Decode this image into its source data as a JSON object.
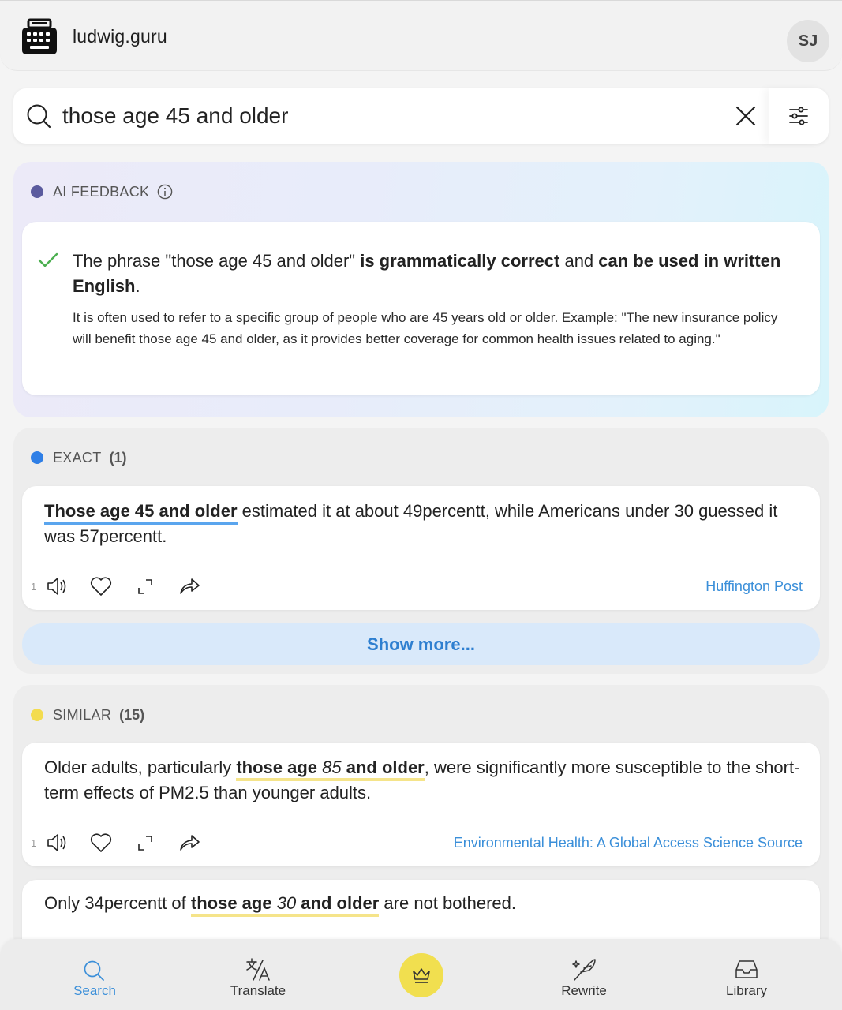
{
  "header": {
    "brand": "ludwig.guru",
    "avatar_initials": "SJ"
  },
  "search": {
    "query": "those age 45 and older",
    "placeholder": ""
  },
  "ai_feedback": {
    "label": "AI FEEDBACK",
    "dot_color": "#5b5b9e",
    "main_parts": [
      "The phrase \"those age 45 and older\" ",
      "is grammatically correct",
      " and ",
      "can be used in written English",
      "."
    ],
    "explanation": "It is often used to refer to a specific group of people who are 45 years old or older. Example: \"The new insurance policy will benefit those age 45 and older, as it provides better coverage for common health issues related to aging.\""
  },
  "exact": {
    "label": "EXACT",
    "count": "(1)",
    "dot_color": "#2f7fe6",
    "results": [
      {
        "index": "1",
        "before": "",
        "highlight": "Those age 45 and older",
        "after": " estimated it at about 49percentt, while Americans under 30 guessed it was 57percentt.",
        "source": "Huffington Post"
      }
    ],
    "show_more": "Show more..."
  },
  "similar": {
    "label": "SIMILAR",
    "count": "(15)",
    "dot_color": "#f3dc4f",
    "results": [
      {
        "index": "1",
        "before": "Older adults, particularly ",
        "hl_a": "those age ",
        "hl_var": "85",
        "hl_b": " and older",
        "after": ", were significantly more susceptible to the short-term effects of PM2.5 than younger adults.",
        "source": "Environmental Health: A Global Access Science Source"
      },
      {
        "before": "Only 34percentt of ",
        "hl_a": "those age ",
        "hl_var": "30",
        "hl_b": " and older",
        "after": " are not bothered."
      }
    ]
  },
  "bottom_nav": {
    "items": [
      {
        "label": "Search",
        "icon": "search-icon",
        "active": true
      },
      {
        "label": "Translate",
        "icon": "translate-icon"
      },
      {
        "label": "",
        "icon": "crown-icon"
      },
      {
        "label": "Rewrite",
        "icon": "quill-icon"
      },
      {
        "label": "Library",
        "icon": "inbox-icon"
      }
    ]
  }
}
